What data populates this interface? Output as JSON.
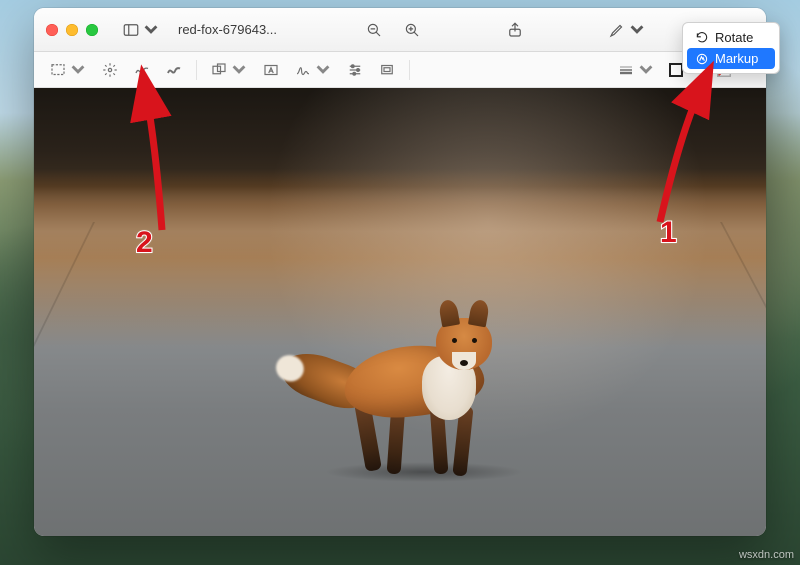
{
  "window": {
    "title": "red-fox-679643..."
  },
  "overflow_menu": {
    "rotate_label": "Rotate",
    "markup_label": "Markup"
  },
  "titlebar_tools": {
    "sidebar": "sidebar-icon",
    "zoom_out": "zoom-out-icon",
    "zoom_in": "zoom-in-icon",
    "share": "share-icon",
    "highlight": "highlight-icon",
    "more": "chevrons-right-icon"
  },
  "markup_tools": {
    "selection": "selection-rect-icon",
    "instant_alpha": "magic-wand-icon",
    "sketch": "sketch-icon",
    "draw": "draw-icon",
    "shapes": "shapes-icon",
    "text": "text-box-icon",
    "sign": "signature-icon",
    "adjust_color": "sliders-icon",
    "crop": "crop-icon",
    "line_style": "line-weight-icon",
    "stroke_color": "stroke-color-swatch",
    "fill_color": "fill-color-swatch"
  },
  "annotations": {
    "callout_1": "1",
    "callout_2": "2"
  },
  "watermark": "wsxdn.com"
}
